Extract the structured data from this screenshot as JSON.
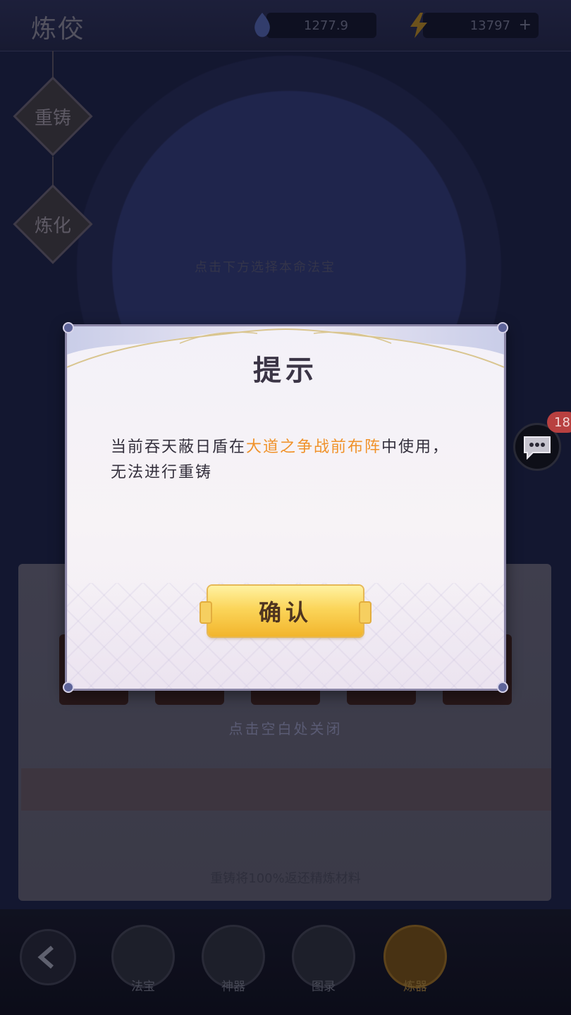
{
  "header": {
    "title": "炼佼",
    "resource_a": "1277.9",
    "resource_b": "13797",
    "add_symbol": "+"
  },
  "side_tabs": [
    {
      "label": "重铸"
    },
    {
      "label": "炼化"
    }
  ],
  "background": {
    "center_hint": "点击下方选择本命法宝",
    "close_hint": "点击空白处关闭",
    "panel_note": "重铸将100%返还精炼材料"
  },
  "chat": {
    "badge": "18"
  },
  "bottom_nav": [
    {
      "label": "法宝"
    },
    {
      "label": "神器"
    },
    {
      "label": "图录"
    },
    {
      "label": "炼器"
    }
  ],
  "dialog": {
    "title": "提示",
    "message_prefix": "当前吞天蔽日盾在",
    "message_highlight": "大道之争战前布阵",
    "message_suffix": "中使用，",
    "message_line2": "无法进行重铸",
    "confirm_label": "确认"
  },
  "colors": {
    "highlight": "#f0922a",
    "button_gold": "#fbd55a",
    "dialog_border": "#8b86a6"
  }
}
